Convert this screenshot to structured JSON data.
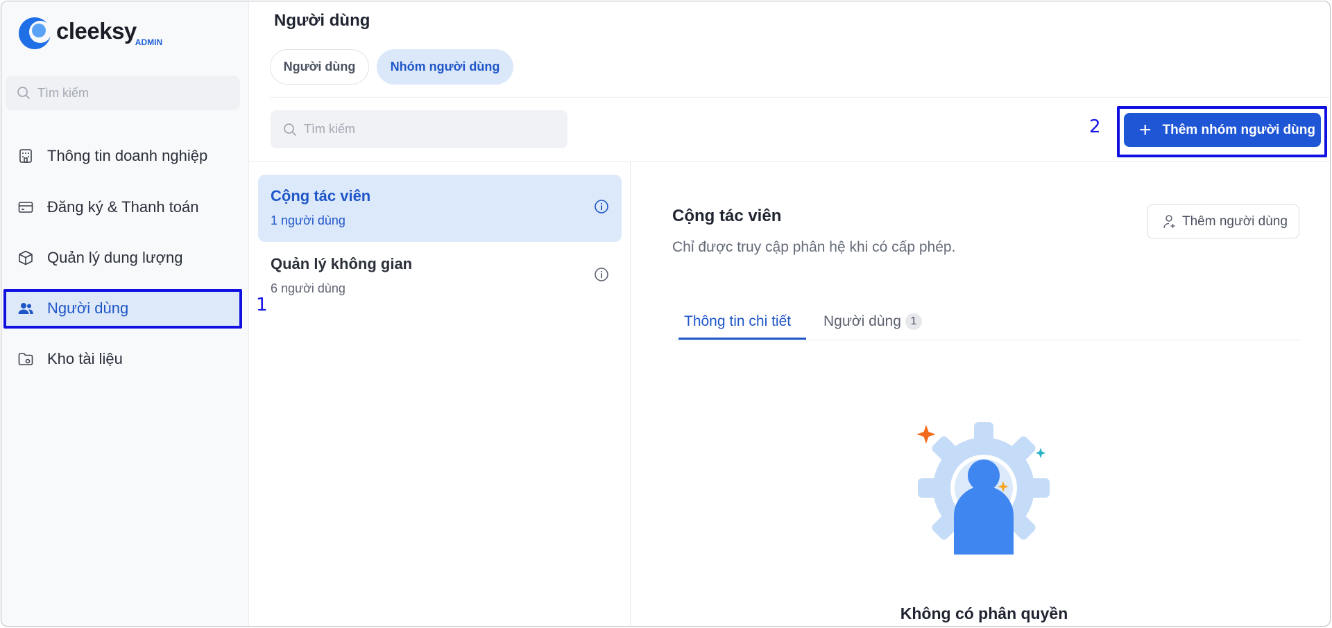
{
  "app": {
    "brand": "cleeksy",
    "brand_sub": "ADMIN"
  },
  "sidebar": {
    "search_placeholder": "Tìm kiếm",
    "items": [
      {
        "label": "Thông tin doanh nghiệp",
        "icon": "building-icon"
      },
      {
        "label": "Đăng ký & Thanh toán",
        "icon": "credit-card-icon"
      },
      {
        "label": "Quản lý dung lượng",
        "icon": "box-icon"
      },
      {
        "label": "Người dùng",
        "icon": "users-icon",
        "active": true
      },
      {
        "label": "Kho tài liệu",
        "icon": "folder-icon"
      }
    ]
  },
  "annotations": {
    "one": "1",
    "two": "2"
  },
  "header": {
    "title": "Người dùng",
    "segments": [
      {
        "label": "Người dùng"
      },
      {
        "label": "Nhóm người dùng",
        "active": true
      }
    ]
  },
  "toolbar": {
    "search_placeholder": "Tìm kiếm",
    "add_group_label": "Thêm nhóm người dùng"
  },
  "groups": [
    {
      "name": "Cộng tác viên",
      "count": "1 người dùng",
      "selected": true
    },
    {
      "name": "Quản lý không gian",
      "count": "6 người dùng"
    }
  ],
  "detail": {
    "title": "Cộng tác viên",
    "description": "Chỉ được truy cập phân hệ khi có cấp phép.",
    "add_user_label": "Thêm người dùng",
    "tabs": [
      {
        "label": "Thông tin chi tiết",
        "active": true
      },
      {
        "label": "Người dùng",
        "badge": "1"
      }
    ],
    "empty_title": "Không có phân quyền"
  },
  "colors": {
    "accent": "#1f56d6",
    "active_bg": "#dce9fa",
    "annotation": "#1414e6"
  }
}
